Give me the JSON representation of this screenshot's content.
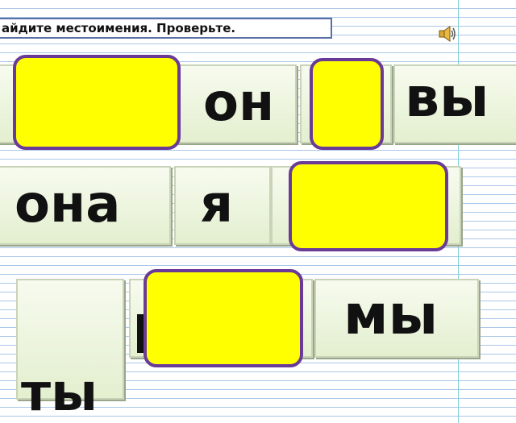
{
  "instruction": "айдите местоимения. Проверьте.",
  "speaker_icon": "speaker-icon",
  "words": {
    "on": "он",
    "vy": "вы",
    "ona": "она",
    "ya": "я",
    "my": "мы",
    "ty": "ты"
  },
  "colors": {
    "cover_fill": "#ffff00",
    "cover_border": "#6a3a97",
    "tile_fill": "#eaf3dc",
    "frame_border": "#5a6fa8"
  }
}
